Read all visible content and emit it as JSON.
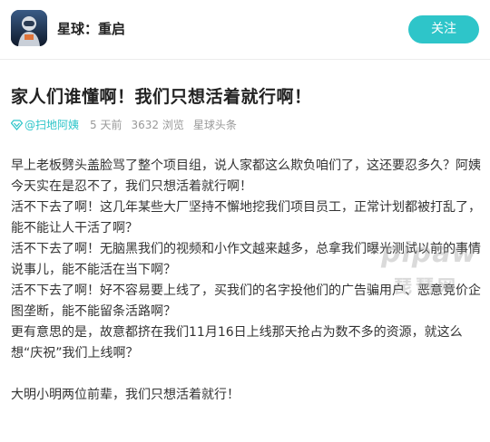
{
  "header": {
    "app_icon": "game-avatar-icon",
    "title": "星球：重启",
    "follow_label": "关注"
  },
  "article": {
    "title": "家人们谁懂啊！我们只想活着就行啊！",
    "author": "@扫地阿姨",
    "time": "5 天前",
    "views": "3632 浏览",
    "source": "星球头条",
    "paragraphs": [
      "早上老板劈头盖脸骂了整个项目组，说人家都这么欺负咱们了，这还要忍多久？阿姨今天实在是忍不了，我们只想活着就行啊！",
      "活不下去了啊！这几年某些大厂坚持不懈地挖我们项目员工，正常计划都被打乱了，能不能让人干活了啊？",
      "活不下去了啊！无脑黑我们的视频和小作文越来越多，总拿我们曝光测试以前的事情说事儿，能不能活在当下啊？",
      "活不下去了啊！好不容易要上线了，买我们的名字投他们的广告骗用户、恶意竞价企图垄断，能不能留条活路啊？",
      "更有意思的是，故意都挤在我们11月16日上线那天抢占为数不多的资源，就这么想“庆祝”我们上线啊？",
      "大明小明两位前辈，我们只想活着就行！"
    ]
  },
  "watermark": {
    "latin": "pipaw",
    "chinese": "琵琶网"
  },
  "colors": {
    "accent": "#2ec5c9",
    "meta_gray": "#999999",
    "text": "#333333"
  }
}
